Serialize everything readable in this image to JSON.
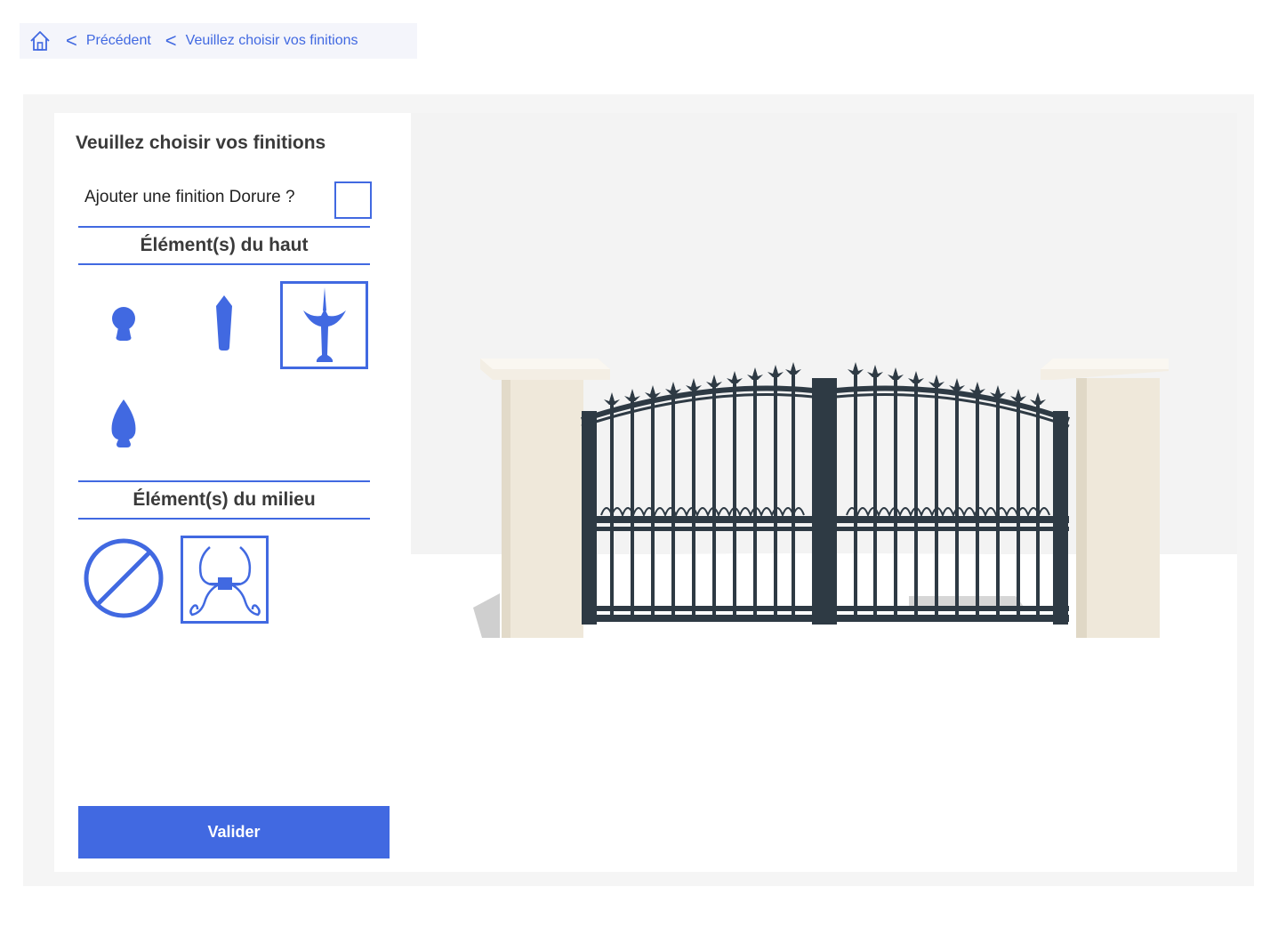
{
  "breadcrumb": {
    "previous_label": "Précédent",
    "current_label": "Veuillez choisir vos finitions"
  },
  "panel": {
    "title": "Veuillez choisir vos finitions",
    "dorure_label": "Ajouter une finition Dorure ?",
    "dorure_checked": false,
    "top_section_title": "Élément(s) du haut",
    "top_options": [
      {
        "icon": "ball-finial-icon",
        "selected": false
      },
      {
        "icon": "pointed-post-icon",
        "selected": false
      },
      {
        "icon": "spear-finial-icon",
        "selected": true
      },
      {
        "icon": "flame-finial-icon",
        "selected": false
      }
    ],
    "middle_section_title": "Élément(s) du milieu",
    "middle_options": [
      {
        "icon": "none-prohibited-icon",
        "selected": false
      },
      {
        "icon": "scroll-ornament-icon",
        "selected": true
      }
    ],
    "validate_label": "Valider"
  },
  "colors": {
    "accent": "#4169e1",
    "gate": "#2e3a44",
    "pillar": "#efe8da"
  }
}
